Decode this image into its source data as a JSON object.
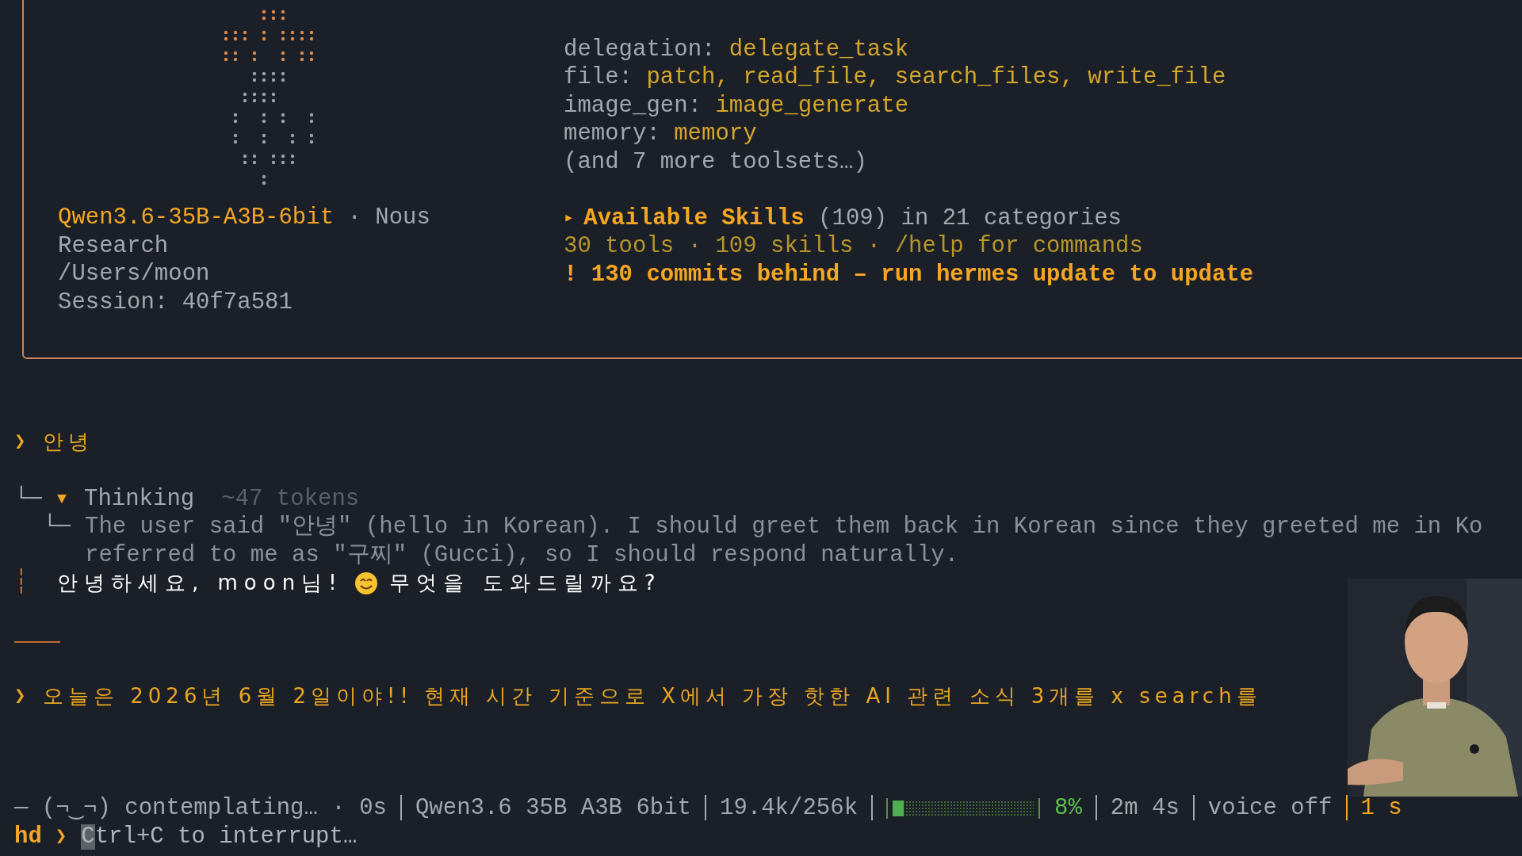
{
  "banner": {
    "model": "Qwen3.6-35B-A3B-6bit",
    "provider": [
      "· Nous",
      "Research"
    ],
    "cwd": "/Users/moon",
    "session": "Session: 40f7a581",
    "toolsets": [
      {
        "category": "delegation:",
        "tools": "delegate_task"
      },
      {
        "category": "file:",
        "tools": "patch, read_file, search_files, write_file"
      },
      {
        "category": "image_gen:",
        "tools": "image_generate"
      },
      {
        "category": "memory:",
        "tools": "memory"
      }
    ],
    "more": "(and 7 more toolsets…)",
    "skills": {
      "marker": "▸",
      "title": "Available Skills",
      "detail": "(109) in 21 categories"
    },
    "summary": "30 tools · 109 skills · /help for commands",
    "warning": "! 130 commits behind – run hermes update to update"
  },
  "conversation": [
    {
      "kind": "user",
      "marker": "❯",
      "text": "안녕"
    },
    {
      "kind": "thinking",
      "branch": "└─",
      "marker": "▼",
      "label": "Thinking",
      "tokens": "~47 tokens",
      "sub_branch": "└─",
      "lines": [
        "The user said \"안녕\" (hello in Korean). I should greet them back in Korean since they greeted me in Ko",
        "referred to me as \"구찌\" (Gucci), so I should respond naturally."
      ]
    },
    {
      "kind": "response",
      "marker": "┆",
      "before": "안녕하세요, moon님!",
      "after": "무엇을 도와드릴까요?"
    },
    {
      "kind": "rule"
    },
    {
      "kind": "user",
      "marker": "❯",
      "text": "오늘은 2026년 6월 2일이야!! 현재 시간 기준으로 X에서 가장 핫한 AI 관련 소식 3개를 x search를"
    }
  ],
  "status_bar": {
    "face": "— (¬‿¬) contemplating… · 0s",
    "model": "Qwen3.6 35B A3B 6bit",
    "tokens": "19.4k/256k",
    "context": {
      "level": 0.08,
      "percent": "8%"
    },
    "elapsed": "2m 4s",
    "voice": "voice off",
    "last": "1 s"
  },
  "prompt": {
    "label": "hd",
    "marker": "❯",
    "hint": "Ctrl+C to interrupt…"
  }
}
